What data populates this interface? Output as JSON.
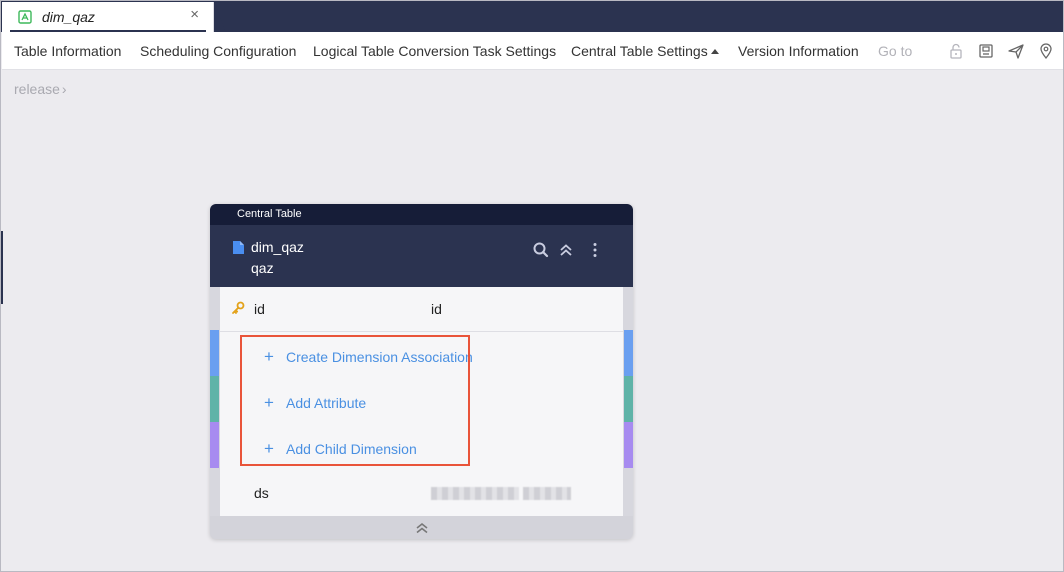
{
  "tab": {
    "title": "dim_qaz",
    "close_glyph": "×",
    "icon": "table-doc-icon",
    "icon_color": "#3db85a"
  },
  "menu": {
    "items": [
      "Table Information",
      "Scheduling Configuration",
      "Logical Table Conversion Task Settings",
      "Central Table Settings",
      "Version Information"
    ],
    "goto": "Go to",
    "tools": [
      "lock-icon",
      "save-icon",
      "send-icon",
      "location-icon"
    ]
  },
  "breadcrumb": {
    "label": "release",
    "chevron": "›"
  },
  "card": {
    "header_label": "Central Table",
    "name": "dim_qaz",
    "subname": "qaz",
    "header_icons": [
      "search-icon",
      "collapse-up-icon",
      "more-vertical-icon"
    ],
    "primary_row": {
      "name": "id",
      "value": "id"
    },
    "actions": [
      "Create Dimension Association",
      "Add Attribute",
      "Add Child Dimension"
    ],
    "plus": "+",
    "ds_row": {
      "name": "ds"
    },
    "stripe_colors": [
      "#6a9ff0",
      "#5fb3a8",
      "#a78bf0"
    ],
    "highlight_color": "#e9543a",
    "link_color": "#4a90e2"
  }
}
